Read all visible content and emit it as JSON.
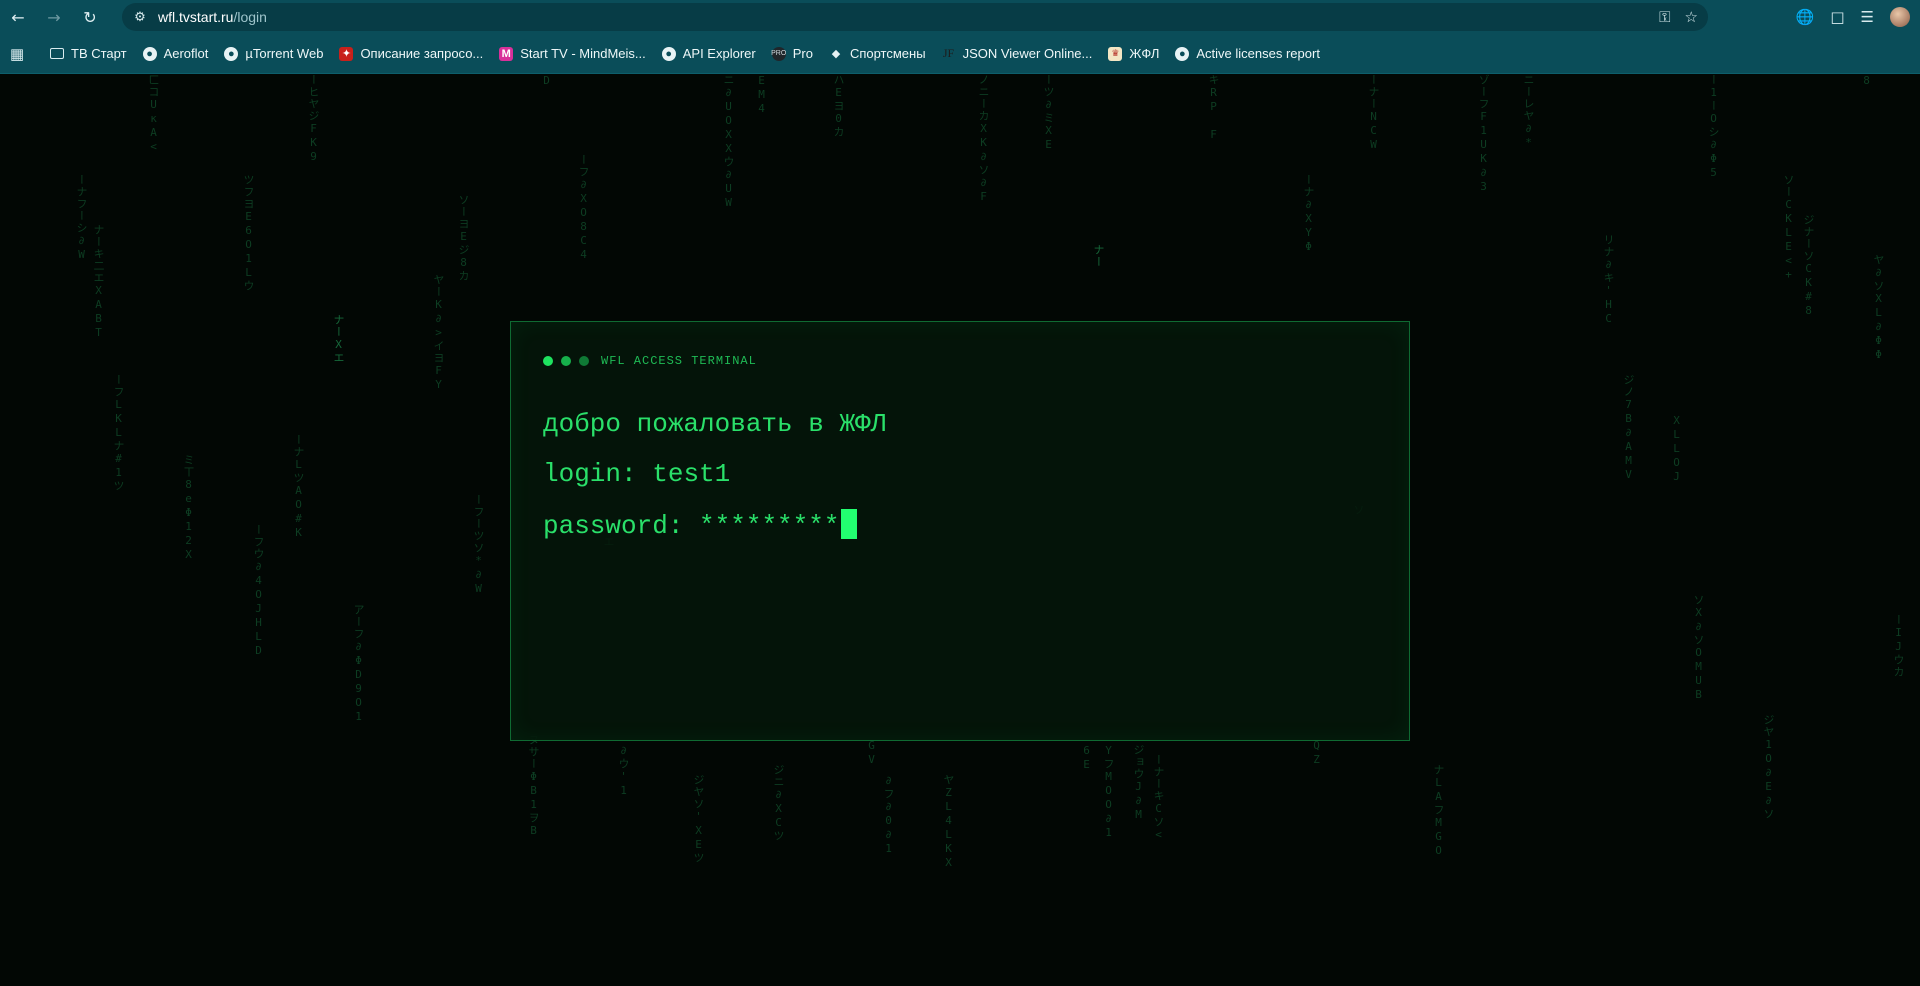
{
  "browser": {
    "url_host": "wfl.tvstart.ru",
    "url_path": "/login",
    "bookmarks": [
      {
        "label": "ТВ Старт",
        "icon": "folder-icon"
      },
      {
        "label": "Aeroflot",
        "icon": "globe-icon"
      },
      {
        "label": "µTorrent Web",
        "icon": "globe-icon"
      },
      {
        "label": "Описание запросо...",
        "icon": "pdf-icon"
      },
      {
        "label": "Start TV - MindMeis...",
        "icon": "mindmeister-icon"
      },
      {
        "label": "API Explorer",
        "icon": "globe-icon"
      },
      {
        "label": "Pro",
        "icon": "pro-icon"
      },
      {
        "label": "Спортсмены",
        "icon": "diamond-icon"
      },
      {
        "label": "JSON Viewer Online...",
        "icon": "jf-icon"
      },
      {
        "label": "ЖФЛ",
        "icon": "wfl-icon"
      },
      {
        "label": "Active licenses report",
        "icon": "globe-icon"
      }
    ]
  },
  "terminal": {
    "title": "WFL ACCESS TERMINAL",
    "welcome": "добро пожаловать в ЖФЛ",
    "login_label": "login:",
    "login_value": "test1",
    "password_label": "password:",
    "password_value": "*********"
  },
  "colors": {
    "accent": "#2ae06a",
    "cursor": "#22ff70",
    "chrome": "#0a4d59"
  }
}
